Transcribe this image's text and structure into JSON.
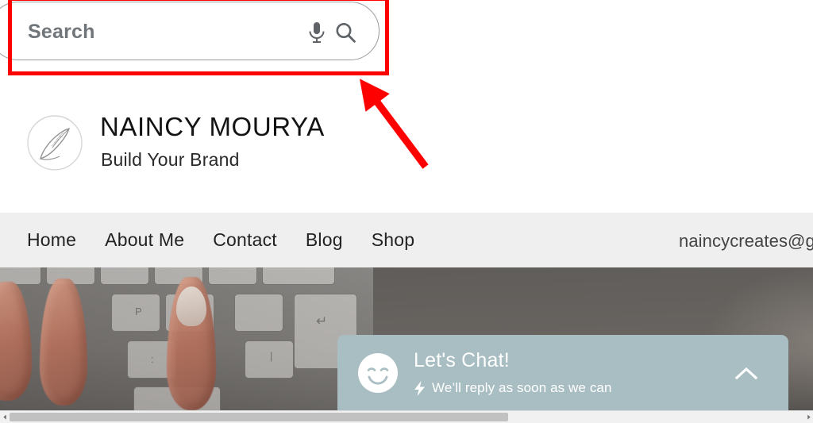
{
  "search": {
    "placeholder": "Search",
    "mic_icon": "microphone-icon",
    "search_icon": "magnifier-icon"
  },
  "annotation": {
    "color": "#ff0000",
    "box_label": "search-box-highlight",
    "arrow_label": "pointer-arrow"
  },
  "brand": {
    "logo_icon": "quill-pen-logo",
    "title": "NAINCY MOURYA",
    "tagline": "Build Your Brand"
  },
  "nav": {
    "background": "#efefef",
    "items": [
      {
        "label": "Home"
      },
      {
        "label": "About Me"
      },
      {
        "label": "Contact"
      },
      {
        "label": "Blog"
      },
      {
        "label": "Shop"
      }
    ],
    "email": "naincycreates@g"
  },
  "hero": {
    "alt": "fingers typing on a white keyboard",
    "key_labels": [
      "P",
      "↵"
    ]
  },
  "chat": {
    "background": "#a9bec2",
    "avatar_icon": "smiley-face-icon",
    "title": "Let's Chat!",
    "bolt_icon": "lightning-bolt-icon",
    "subtitle": "We’ll reply as soon as we can",
    "collapse_icon": "chevron-up-icon"
  },
  "scrollbar": {
    "left_arrow": "scroll-left-arrow",
    "right_arrow": "scroll-right-arrow"
  }
}
